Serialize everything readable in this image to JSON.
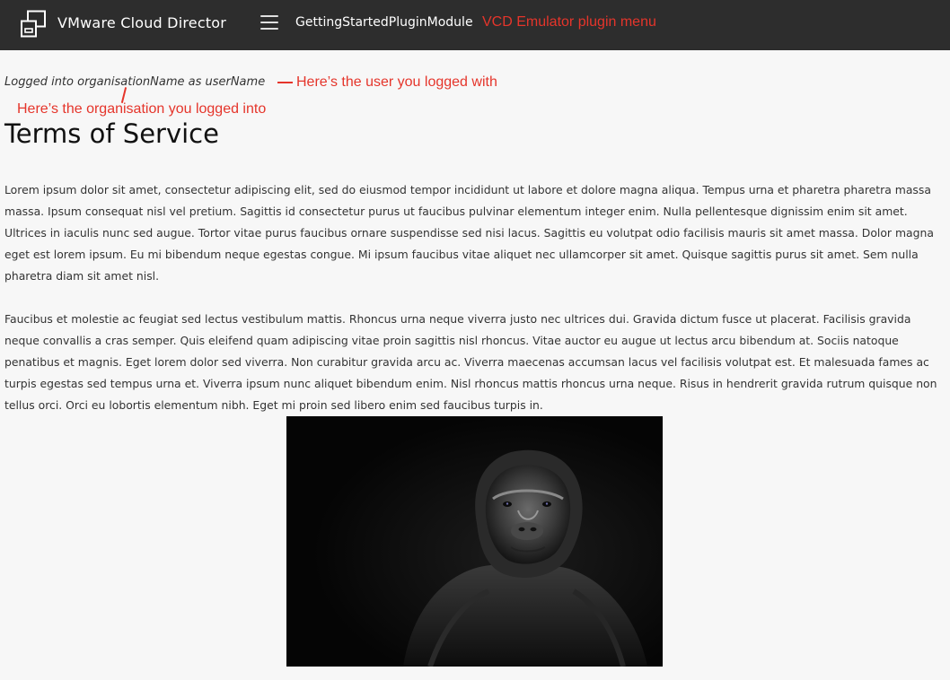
{
  "header": {
    "app_title": "VMware Cloud Director",
    "plugin_link": "GettingStartedPluginModule",
    "logo_icon": "vmware-cloud-director-logo",
    "menu_icon": "hamburger-menu-icon",
    "background_color": "#2d2d2d"
  },
  "annotations": {
    "plugin_menu": "VCD Emulator plugin menu",
    "user": "Here’s the user you logged with",
    "organisation": "Here’s the organisation you logged into",
    "color": "#e5352b"
  },
  "main": {
    "logged_in_text": "Logged into organisationName as userName",
    "title": "Terms of Service",
    "paragraphs": [
      "Lorem ipsum dolor sit amet, consectetur adipiscing elit, sed do eiusmod tempor incididunt ut labore et dolore magna aliqua. Tempus urna et pharetra pharetra massa massa. Ipsum consequat nisl vel pretium. Sagittis id consectetur purus ut faucibus pulvinar elementum integer enim. Nulla pellentesque dignissim enim sit amet. Ultrices in iaculis nunc sed augue. Tortor vitae purus faucibus ornare suspendisse sed nisi lacus. Sagittis eu volutpat odio facilisis mauris sit amet massa. Dolor magna eget est lorem ipsum. Eu mi bibendum neque egestas congue. Mi ipsum faucibus vitae aliquet nec ullamcorper sit amet. Quisque sagittis purus sit amet. Sem nulla pharetra diam sit amet nisl.",
      "Faucibus et molestie ac feugiat sed lectus vestibulum mattis. Rhoncus urna neque viverra justo nec ultrices dui. Gravida dictum fusce ut placerat. Facilisis gravida neque convallis a cras semper. Quis eleifend quam adipiscing vitae proin sagittis nisl rhoncus. Vitae auctor eu augue ut lectus arcu bibendum at. Sociis natoque penatibus et magnis. Eget lorem dolor sed viverra. Non curabitur gravida arcu ac. Viverra maecenas accumsan lacus vel facilisis volutpat est. Et malesuada fames ac turpis egestas sed tempus urna et. Viverra ipsum nunc aliquet bibendum enim. Nisl rhoncus mattis rhoncus urna neque. Risus in hendrerit gravida rutrum quisque non tellus orci. Orci eu lobortis elementum nibh. Eget mi proin sed libero enim sed faucibus turpis in."
    ],
    "image_subject": "gorilla-portrait-image"
  }
}
